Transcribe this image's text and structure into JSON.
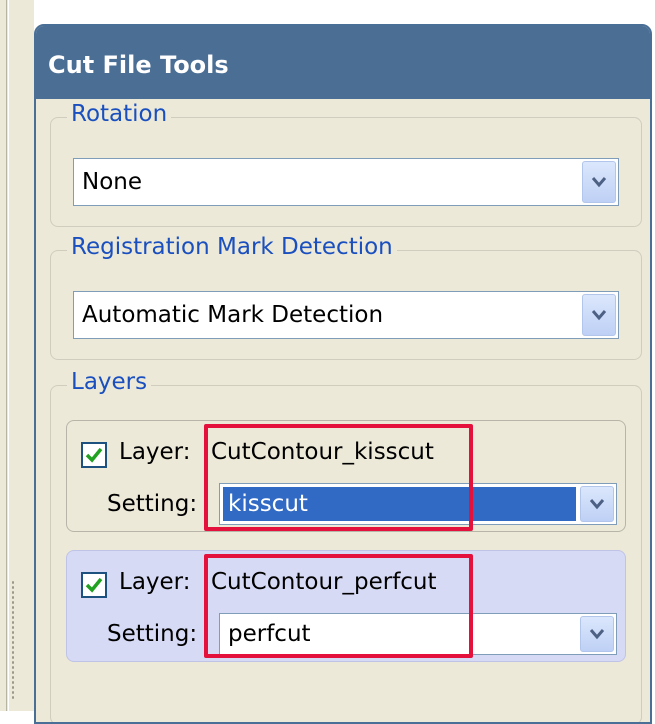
{
  "panel": {
    "title": "Cut File Tools"
  },
  "rotation": {
    "group_label": "Rotation",
    "selected": "None"
  },
  "registration": {
    "group_label": "Registration Mark Detection",
    "selected": "Automatic Mark Detection"
  },
  "layers": {
    "group_label": "Layers",
    "items": [
      {
        "checked": true,
        "layer_label": "Layer:",
        "layer_name": "CutContour_kisscut",
        "setting_label": "Setting:",
        "setting_value": "kisscut"
      },
      {
        "checked": true,
        "layer_label": "Layer:",
        "layer_name": "CutContour_perfcut",
        "setting_label": "Setting:",
        "setting_value": "perfcut"
      }
    ]
  },
  "colors": {
    "header": "#4b6e95",
    "panel_bg": "#ece9d8",
    "group_label": "#1a4fbf",
    "selection": "#316ac5",
    "highlight": "#e5113d",
    "active_layer_bg": "#d7daf5"
  }
}
